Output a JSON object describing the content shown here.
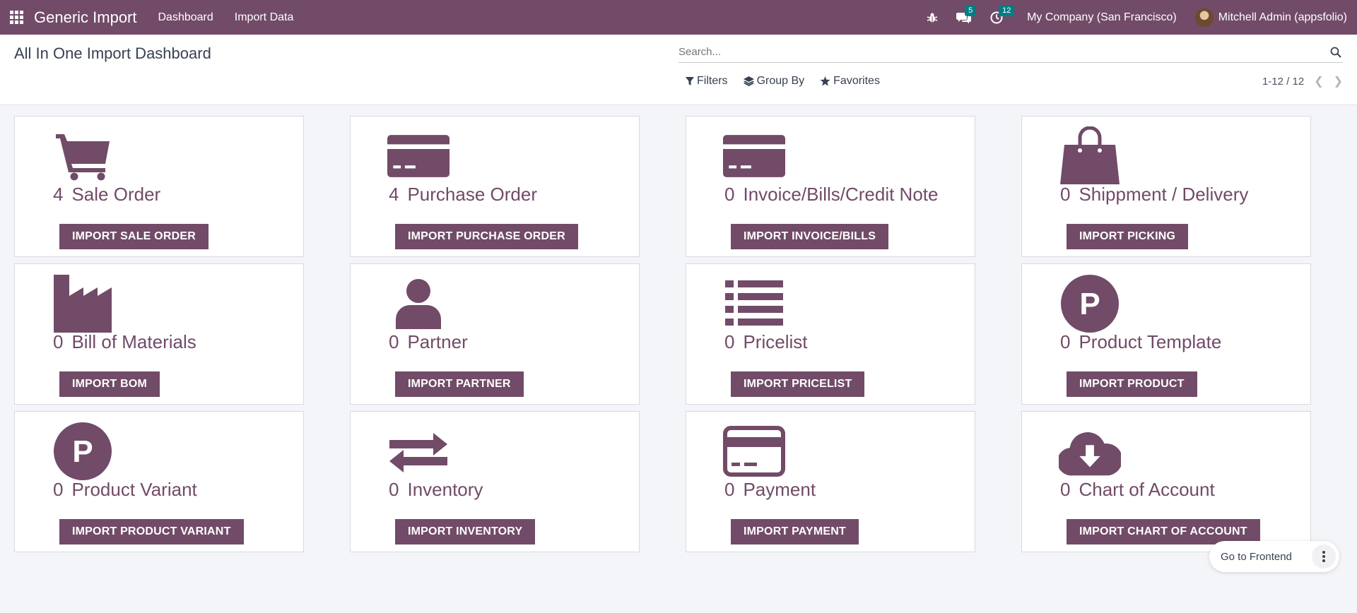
{
  "navbar": {
    "app_name": "Generic Import",
    "menus": [
      "Dashboard",
      "Import Data"
    ],
    "messages_count": "5",
    "activities_count": "12",
    "company": "My Company (San Francisco)",
    "user": "Mitchell Admin (appsfolio)"
  },
  "control_panel": {
    "title": "All In One Import Dashboard",
    "search_placeholder": "Search...",
    "filters_label": "Filters",
    "group_by_label": "Group By",
    "favorites_label": "Favorites",
    "pager": "1-12 / 12"
  },
  "cards": [
    {
      "icon": "cart-icon",
      "count": "4",
      "title": "Sale Order",
      "button": "IMPORT SALE ORDER"
    },
    {
      "icon": "credit-card-icon",
      "count": "4",
      "title": "Purchase Order",
      "button": "IMPORT PURCHASE ORDER"
    },
    {
      "icon": "credit-card-icon",
      "count": "0",
      "title": "Invoice/Bills/Credit Note",
      "button": "IMPORT INVOICE/BILLS"
    },
    {
      "icon": "shopping-bag-icon",
      "count": "0",
      "title": "Shippment / Delivery",
      "button": "IMPORT PICKING"
    },
    {
      "icon": "factory-icon",
      "count": "0",
      "title": "Bill of Materials",
      "button": "IMPORT BOM"
    },
    {
      "icon": "user-icon",
      "count": "0",
      "title": "Partner",
      "button": "IMPORT PARTNER"
    },
    {
      "icon": "list-icon",
      "count": "0",
      "title": "Pricelist",
      "button": "IMPORT PRICELIST"
    },
    {
      "icon": "parking-circle-icon",
      "count": "0",
      "title": "Product Template",
      "button": "IMPORT PRODUCT"
    },
    {
      "icon": "parking-circle-icon",
      "count": "0",
      "title": "Product Variant",
      "button": "IMPORT PRODUCT VARIANT"
    },
    {
      "icon": "exchange-icon",
      "count": "0",
      "title": "Inventory",
      "button": "IMPORT INVENTORY"
    },
    {
      "icon": "credit-card-outline-icon",
      "count": "0",
      "title": "Payment",
      "button": "IMPORT PAYMENT"
    },
    {
      "icon": "cloud-download-icon",
      "count": "0",
      "title": "Chart of Account",
      "button": "IMPORT CHART OF ACCOUNT"
    }
  ],
  "floating": {
    "go_to_frontend": "Go to Frontend"
  },
  "colors": {
    "brand": "#714b67",
    "badge": "#017e84",
    "background": "#f4f5f9"
  }
}
